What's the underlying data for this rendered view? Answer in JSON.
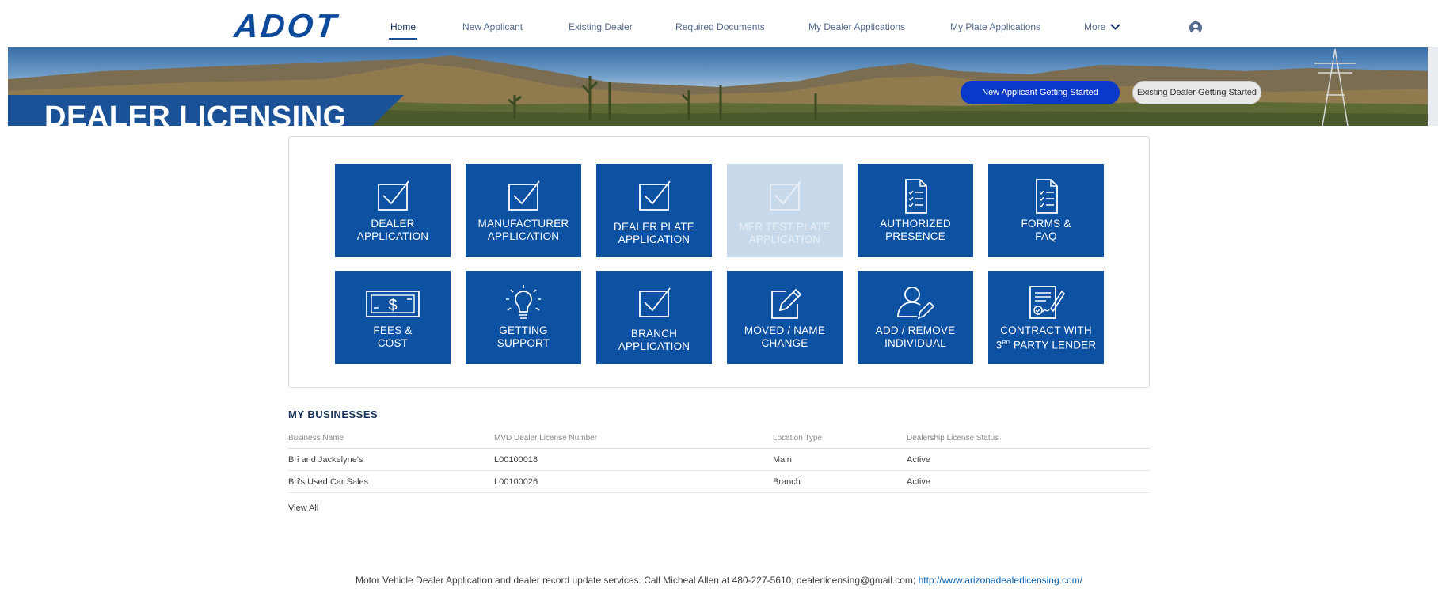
{
  "header": {
    "logo_text": "ADOT",
    "nav": [
      {
        "label": "Home",
        "active": true
      },
      {
        "label": "New Applicant"
      },
      {
        "label": "Existing Dealer"
      },
      {
        "label": "Required Documents"
      },
      {
        "label": "My Dealer Applications"
      },
      {
        "label": "My Plate Applications"
      },
      {
        "label": "More"
      }
    ],
    "icons": {
      "more": "chevron-down-icon",
      "user": "user-avatar-icon"
    }
  },
  "banner": {
    "title": "DEALER LICENSING",
    "primary_button": "New Applicant Getting Started",
    "secondary_button": "Existing Dealer Getting Started"
  },
  "tiles": [
    {
      "label": "Dealer\nApplication",
      "icon": "checkbox-icon",
      "enabled": true
    },
    {
      "label": "Manufacturer\nApplication",
      "icon": "checkbox-icon",
      "enabled": true
    },
    {
      "label": "Dealer Plate\nApplication",
      "icon": "checkbox-icon",
      "enabled": true
    },
    {
      "label": "MFR Test Plate\nApplication",
      "icon": "checkbox-icon",
      "enabled": false
    },
    {
      "label": "Authorized\nPresence",
      "icon": "checklist-document-icon",
      "enabled": true
    },
    {
      "label": "Forms &\nFAQ",
      "icon": "checklist-document-icon",
      "enabled": true
    },
    {
      "label": "Fees &\nCost",
      "icon": "dollar-bill-icon",
      "enabled": true
    },
    {
      "label": "Getting\nSupport",
      "icon": "lightbulb-icon",
      "enabled": true
    },
    {
      "label": "Branch\nApplication",
      "icon": "checkbox-icon",
      "enabled": true
    },
    {
      "label": "Moved / Name\nChange",
      "icon": "edit-pencil-icon",
      "enabled": true
    },
    {
      "label": "Add / Remove\nIndividual",
      "icon": "user-edit-icon",
      "enabled": true
    },
    {
      "label": "Contract with\n3rd Party Lender",
      "icon": "signed-contract-icon",
      "enabled": true
    }
  ],
  "businesses": {
    "title": "MY BUSINESSES",
    "columns": [
      "Business Name",
      "MVD Dealer License Number",
      "Location Type",
      "Dealership License Status"
    ],
    "rows": [
      [
        "Bri and Jackelyne's",
        "L00100018",
        "Main",
        "Active"
      ],
      [
        "Bri's Used Car Sales",
        "L00100026",
        "Branch",
        "Active"
      ]
    ],
    "view_all": "View All"
  },
  "footer": {
    "text": "Motor Vehicle Dealer Application and dealer record update services.  Call Micheal Allen at 480-227-5610; dealerlicensing@gmail.com; ",
    "link": "http://www.arizonadealerlicensing.com/"
  },
  "colors": {
    "brand_blue": "#0d51a3",
    "primary_button": "#0a38c8",
    "disabled_tile": "#c9d9ec"
  }
}
